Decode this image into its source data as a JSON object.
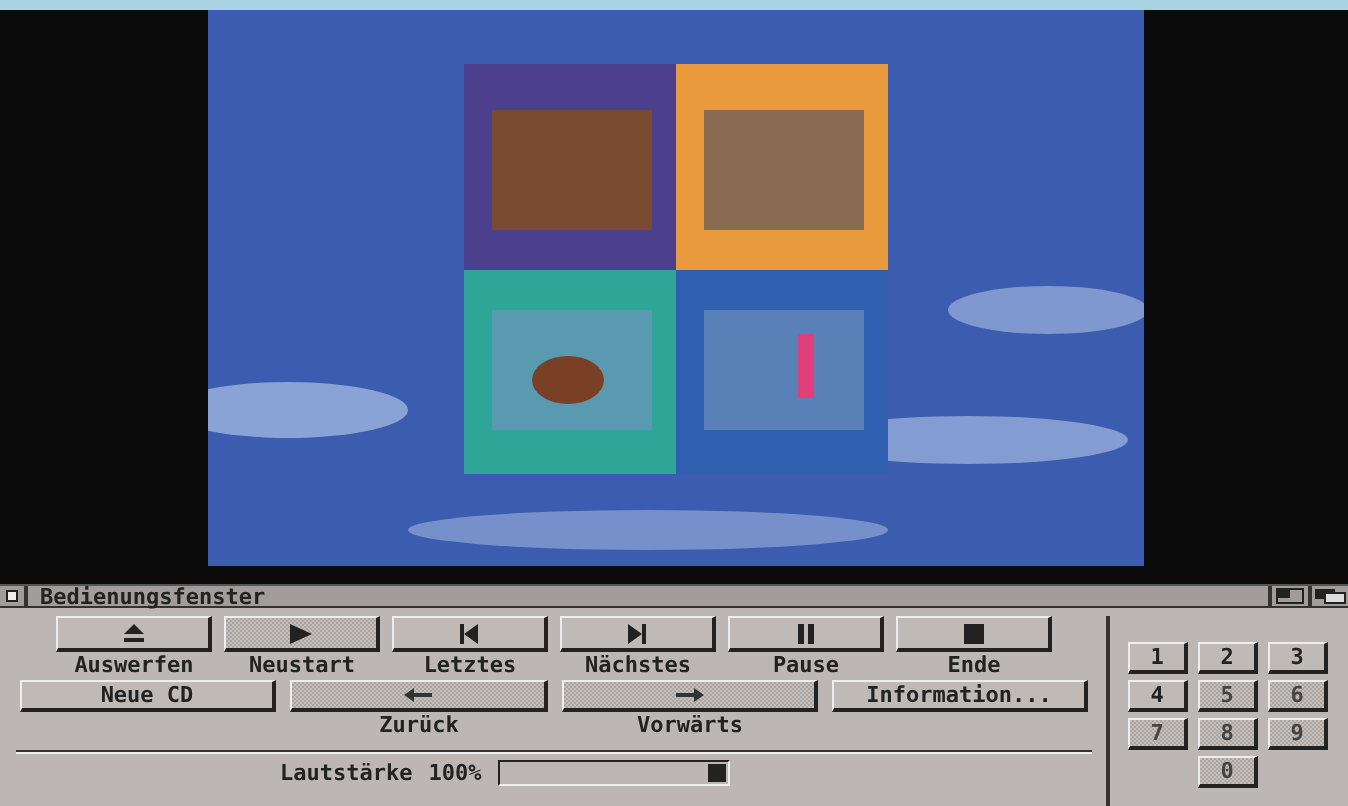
{
  "window": {
    "title": "Bedienungsfenster"
  },
  "transport": [
    {
      "label": "Auswerfen",
      "disabled": false
    },
    {
      "label": "Neustart",
      "disabled": true
    },
    {
      "label": "Letztes",
      "disabled": false
    },
    {
      "label": "Nächstes",
      "disabled": false
    },
    {
      "label": "Pause",
      "disabled": false
    },
    {
      "label": "Ende",
      "disabled": false
    }
  ],
  "actions": [
    {
      "kind": "text",
      "label": "Neue CD",
      "disabled": false
    },
    {
      "kind": "seek",
      "label": "Zurück",
      "disabled": true
    },
    {
      "kind": "seek",
      "label": "Vorwärts",
      "disabled": true
    },
    {
      "kind": "text",
      "label": "Information...",
      "disabled": false
    }
  ],
  "volume": {
    "label": "Lautstärke",
    "reading": "100%",
    "level": 1
  },
  "tracks": [
    {
      "label": "1",
      "disabled": false
    },
    {
      "label": "2",
      "disabled": false
    },
    {
      "label": "3",
      "disabled": false
    },
    {
      "label": "4",
      "disabled": false
    },
    {
      "label": "5",
      "disabled": true
    },
    {
      "label": "6",
      "disabled": true
    },
    {
      "label": "7",
      "disabled": true
    },
    {
      "label": "8",
      "disabled": true
    },
    {
      "label": "9",
      "disabled": true
    },
    {
      "label": "0",
      "disabled": true
    }
  ]
}
